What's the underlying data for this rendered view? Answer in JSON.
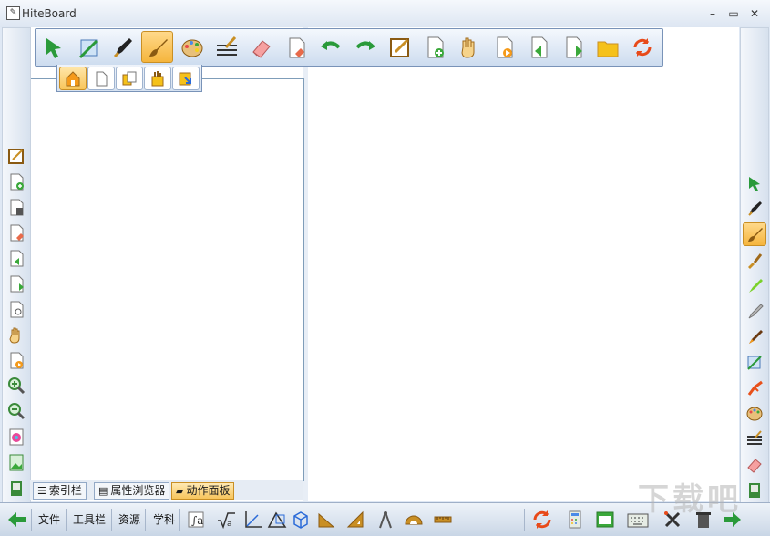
{
  "window": {
    "title": "HiteBoard",
    "app_icon_glyph": "✎",
    "minimize": "–",
    "maximize": "▭",
    "close": "✕"
  },
  "toolbar": {
    "items": [
      "select-arrow",
      "magic-pen",
      "fountain-pen",
      "brush",
      "color-palette",
      "line-style",
      "eraser",
      "page-eraser",
      "undo",
      "redo",
      "edit-note",
      "new-page",
      "hand-pan",
      "play-page",
      "prev-page",
      "next-page",
      "open-folder",
      "refresh"
    ],
    "active": "brush"
  },
  "panel_tabs": {
    "items": [
      "home",
      "blank-page",
      "copy-pages",
      "resources",
      "export"
    ],
    "active": "home"
  },
  "left_rail": {
    "items": [
      "edit-note",
      "add-page",
      "delete-page",
      "page-eraser",
      "prev-page",
      "next-page",
      "zoom-page",
      "hand-pan",
      "play-page",
      "zoom-in",
      "zoom-out",
      "color-wheel",
      "image",
      "recycle"
    ]
  },
  "right_rail": {
    "items": [
      "select-arrow",
      "fountain-pen",
      "brush",
      "paint-brush",
      "highlighter",
      "marker",
      "crayon",
      "magic-pen",
      "laser-pen",
      "color-palette",
      "line-style",
      "eraser",
      "recycle"
    ],
    "active": "brush"
  },
  "bottom_tabs": [
    {
      "icon": "list-icon",
      "label": "索引栏"
    },
    {
      "icon": "properties-icon",
      "label": "属性浏览器"
    },
    {
      "icon": "animation-icon",
      "label": "动作面板"
    }
  ],
  "bottom_tabs_active": 2,
  "statusbar": {
    "menus": [
      "文件",
      "工具栏",
      "资源",
      "学科"
    ],
    "tools": [
      "formula-edit",
      "formula-sqrt",
      "coordinate-axes",
      "geometry-shapes",
      "3d-cube",
      "triangle-ruler",
      "set-square",
      "compass",
      "protractor",
      "ruler"
    ],
    "right_tools": [
      "refresh",
      "calculator",
      "screen-capture",
      "keyboard",
      "tools",
      "trash"
    ]
  },
  "watermark": "下载吧"
}
